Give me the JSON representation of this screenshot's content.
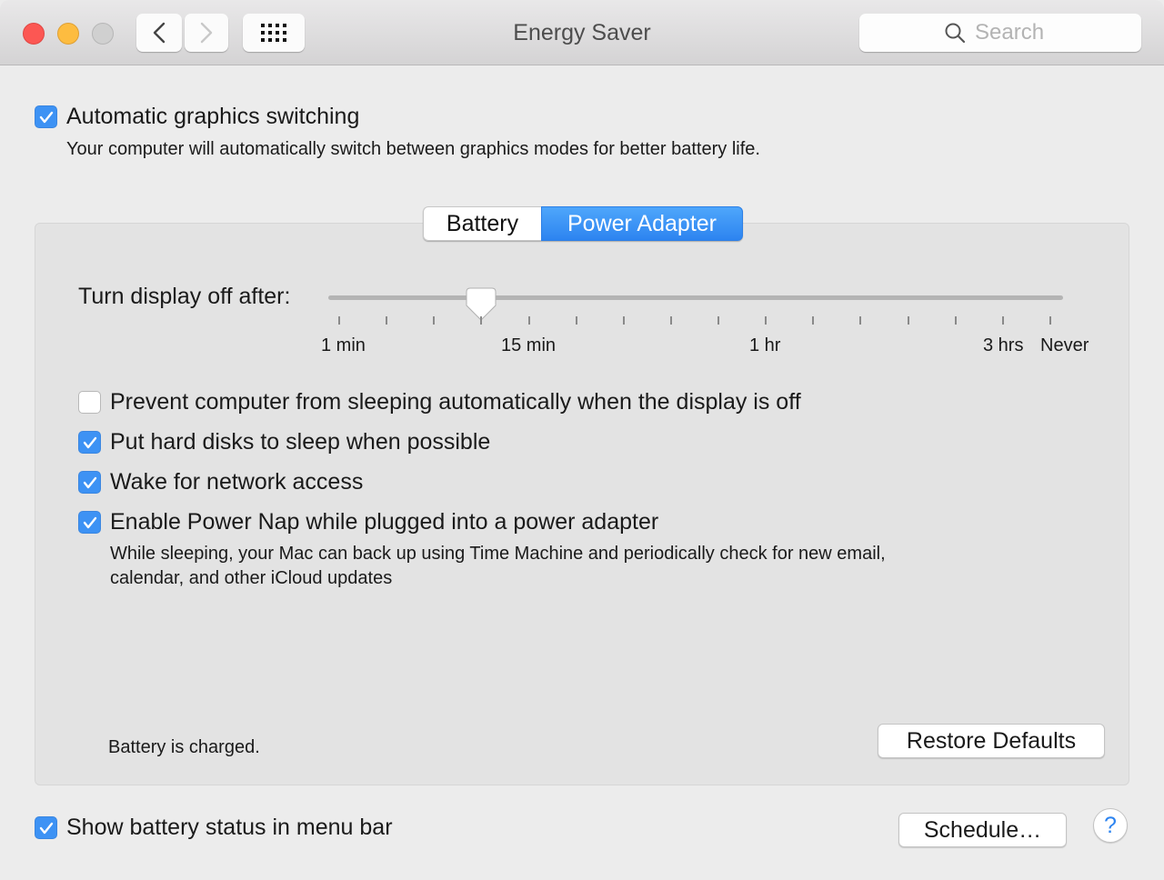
{
  "window": {
    "title": "Energy Saver",
    "search_placeholder": "Search",
    "traffic_lights": {
      "close": "#fc5753",
      "minimize": "#fdbc40",
      "zoom": "#d0d0d0"
    }
  },
  "graphics": {
    "label": "Automatic graphics switching",
    "checked": true,
    "description": "Your computer will automatically switch between graphics modes for better battery life."
  },
  "tabs": [
    {
      "label": "Battery",
      "selected": false
    },
    {
      "label": "Power Adapter",
      "selected": true
    }
  ],
  "display_slider": {
    "label": "Turn display off after:",
    "tick_count": 16,
    "selected_tick_index": 3,
    "selected_value": "15 min",
    "tick_labels": [
      "1 min",
      "15 min",
      "1 hr",
      "3 hrs",
      "Never"
    ]
  },
  "options": [
    {
      "label": "Prevent computer from sleeping automatically when the display is off",
      "checked": false
    },
    {
      "label": "Put hard disks to sleep when possible",
      "checked": true
    },
    {
      "label": "Wake for network access",
      "checked": true
    },
    {
      "label": "Enable Power Nap while plugged into a power adapter",
      "checked": true
    }
  ],
  "power_nap_description_line1": "While sleeping, your Mac can back up using Time Machine and periodically check for new email,",
  "power_nap_description_line2": "calendar, and other iCloud updates",
  "status": "Battery is charged.",
  "restore_defaults_label": "Restore Defaults",
  "footer": {
    "show_battery_label": "Show battery status in menu bar",
    "show_battery_checked": true,
    "schedule_label": "Schedule…",
    "help_label": "?"
  },
  "colors": {
    "accent": "#3d92f4",
    "panel": "#e3e3e3",
    "window": "#ececec"
  }
}
